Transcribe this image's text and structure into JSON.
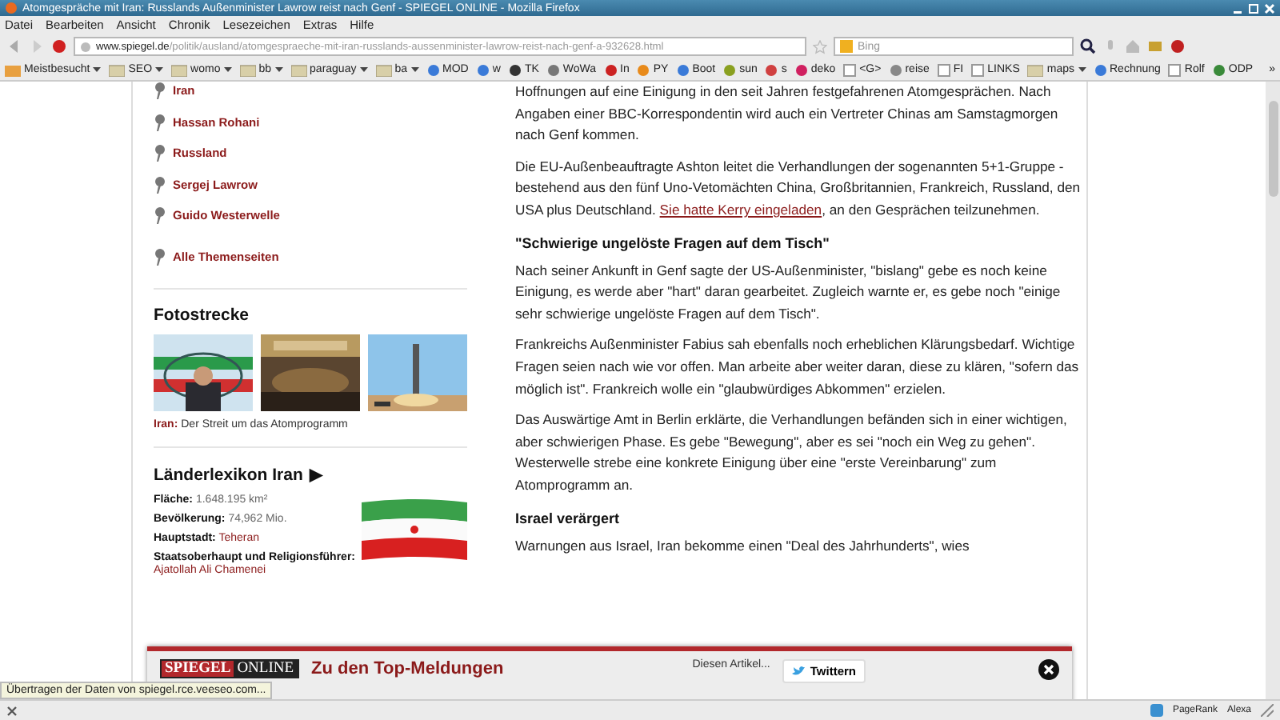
{
  "window": {
    "title": "Atomgespräche mit Iran: Russlands Außenminister Lawrow reist nach Genf - SPIEGEL ONLINE - Mozilla Firefox"
  },
  "menu": [
    "Datei",
    "Bearbeiten",
    "Ansicht",
    "Chronik",
    "Lesezeichen",
    "Extras",
    "Hilfe"
  ],
  "navigation": {
    "url_host": "www.spiegel.de",
    "url_path": "/politik/ausland/atomgespraeche-mit-iran-russlands-aussenminister-lawrow-reist-nach-genf-a-932628.html",
    "search_placeholder": "Bing"
  },
  "bookmarks": [
    {
      "label": "Meistbesucht",
      "kind": "special",
      "dropdown": true
    },
    {
      "label": "SEO",
      "kind": "folder",
      "dropdown": true
    },
    {
      "label": "womo",
      "kind": "folder",
      "dropdown": true
    },
    {
      "label": "bb",
      "kind": "folder",
      "dropdown": true
    },
    {
      "label": "paraguay",
      "kind": "folder",
      "dropdown": true
    },
    {
      "label": "ba",
      "kind": "folder",
      "dropdown": true
    },
    {
      "label": "MOD",
      "kind": "link",
      "color": "#3a7ad8",
      "dropdown": false
    },
    {
      "label": "w",
      "kind": "link",
      "color": "#3a7ad8",
      "dropdown": false
    },
    {
      "label": "TK",
      "kind": "link",
      "color": "#333333",
      "dropdown": false
    },
    {
      "label": "WoWa",
      "kind": "link",
      "color": "#777777",
      "dropdown": false
    },
    {
      "label": "In",
      "kind": "link",
      "color": "#cc2222",
      "dropdown": false
    },
    {
      "label": "PY",
      "kind": "link",
      "color": "#e88a1a",
      "dropdown": false
    },
    {
      "label": "Boot",
      "kind": "link",
      "color": "#3a7ad8",
      "dropdown": false
    },
    {
      "label": "sun",
      "kind": "link",
      "color": "#8aa020",
      "dropdown": false
    },
    {
      "label": "s",
      "kind": "link",
      "color": "#d04040",
      "dropdown": false
    },
    {
      "label": "deko",
      "kind": "link",
      "color": "#d02060",
      "dropdown": false
    },
    {
      "label": "<G>",
      "kind": "page",
      "dropdown": false
    },
    {
      "label": "reise",
      "kind": "link",
      "color": "#888888",
      "dropdown": false
    },
    {
      "label": "FI",
      "kind": "page",
      "dropdown": false
    },
    {
      "label": "LINKS",
      "kind": "page",
      "dropdown": false
    },
    {
      "label": "maps",
      "kind": "folder",
      "dropdown": true
    },
    {
      "label": "Rechnung",
      "kind": "link",
      "color": "#3a7ad8",
      "dropdown": false
    },
    {
      "label": "Rolf",
      "kind": "page",
      "dropdown": false
    },
    {
      "label": "ODP",
      "kind": "link",
      "color": "#3a8a3a",
      "dropdown": false
    }
  ],
  "bookmarks_more": "»",
  "topics": [
    "Iran",
    "Hassan Rohani",
    "Russland",
    "Sergej Lawrow",
    "Guido Westerwelle"
  ],
  "topics_all": "Alle Themenseiten",
  "gallery": {
    "title": "Fotostrecke",
    "caption": "**Iran:** Der Streit um das Atomprogramm"
  },
  "country": {
    "title": "Länderlexikon Iran",
    "arrow": "▶",
    "facts": [
      {
        "label": "Fläche:",
        "value": "1.648.195 km²",
        "kind": "plain"
      },
      {
        "label": "Bevölkerung:",
        "value": "74,962 Mio.",
        "kind": "plain"
      },
      {
        "label": "Hauptstadt:",
        "value": "Teheran",
        "kind": "link"
      },
      {
        "label": "Staatsoberhaupt und Religionsführer:",
        "value": "Ajatollah Ali Chamenei",
        "kind": "link"
      }
    ]
  },
  "article": [
    {
      "kind": "paragraph",
      "text": "Hoffnungen auf eine Einigung in den seit Jahren festgefahrenen Atomgesprächen. Nach Angaben einer BBC-Korrespondentin wird auch ein Vertreter Chinas am Samstagmorgen nach Genf kommen."
    },
    {
      "kind": "paragraph",
      "text": "Die EU-Außenbeauftragte Ashton leitet die Verhandlungen der sogenannten 5+1-Gruppe - bestehend aus den fünf Uno-Vetomächten China, Großbritannien, Frankreich, Russland, den USA plus Deutschland.",
      "link": "Sie hatte Kerry eingeladen",
      "after": ", an den Gesprächen teilzunehmen."
    },
    {
      "kind": "heading",
      "text": "\"Schwierige ungelöste Fragen auf dem Tisch\""
    },
    {
      "kind": "paragraph",
      "text": "Nach seiner Ankunft in Genf sagte der US-Außenminister, \"bislang\" gebe es noch keine Einigung, es werde aber \"hart\" daran gearbeitet. Zugleich warnte er, es gebe noch \"einige sehr schwierige ungelöste Fragen auf dem Tisch\"."
    },
    {
      "kind": "paragraph",
      "text": "Frankreichs Außenminister Fabius sah ebenfalls noch erheblichen Klärungsbedarf. Wichtige Fragen seien nach wie vor offen. Man arbeite aber weiter daran, diese zu klären, \"sofern das möglich ist\". Frankreich wolle ein \"glaubwürdiges Abkommen\" erzielen."
    },
    {
      "kind": "paragraph",
      "text": "Das Auswärtige Amt in Berlin erklärte, die Verhandlungen befänden sich in einer wichtigen, aber schwierigen Phase. Es gebe \"Bewegung\", aber es sei \"noch ein Weg zu gehen\". Westerwelle strebe eine konkrete Einigung über eine \"erste Vereinbarung\" zum Atomprogramm an."
    },
    {
      "kind": "heading",
      "text": "Israel verärgert"
    },
    {
      "kind": "paragraph",
      "text": "Warnungen aus Israel, Iran bekomme einen \"Deal des Jahrhunderts\", wies"
    }
  ],
  "promo_bar": {
    "logo_left": "SPIEGEL",
    "logo_right": "ONLINE",
    "headline": "Zu den Top-Meldungen",
    "share_label": "Diesen Artikel...",
    "share_button": "Twittern"
  },
  "status": {
    "message": "Übertragen der Daten von spiegel.rce.veeseo.com...",
    "pagerank": "PageRank",
    "alexa": "Alexa"
  }
}
